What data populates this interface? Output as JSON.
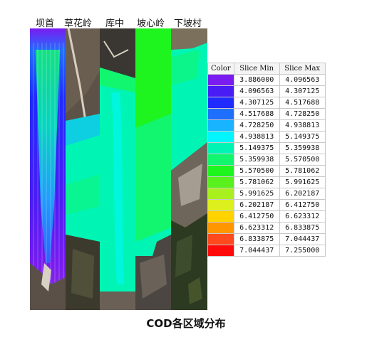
{
  "chart_data": {
    "type": "heatmap",
    "title": "COD各区域分布",
    "stations": [
      "坝首",
      "草花岭",
      "库中",
      "坡心岭",
      "下坡村"
    ],
    "legend_headers": [
      "Color",
      "Slice Min",
      "Slice Max"
    ],
    "bins": [
      {
        "min": "3.886000",
        "max": "4.096563",
        "color": "#7a1cf0"
      },
      {
        "min": "4.096563",
        "max": "4.307125",
        "color": "#4a1cf5"
      },
      {
        "min": "4.307125",
        "max": "4.517688",
        "color": "#1f2bff"
      },
      {
        "min": "4.517688",
        "max": "4.728250",
        "color": "#1f6fff"
      },
      {
        "min": "4.728250",
        "max": "4.938813",
        "color": "#18b4ff"
      },
      {
        "min": "4.938813",
        "max": "5.149375",
        "color": "#00f5ff"
      },
      {
        "min": "5.149375",
        "max": "5.359938",
        "color": "#00f5b4"
      },
      {
        "min": "5.359938",
        "max": "5.570500",
        "color": "#12f56e"
      },
      {
        "min": "5.570500",
        "max": "5.781062",
        "color": "#1ef51e"
      },
      {
        "min": "5.781062",
        "max": "5.991625",
        "color": "#5af01e"
      },
      {
        "min": "5.991625",
        "max": "6.202187",
        "color": "#a8f01e"
      },
      {
        "min": "6.202187",
        "max": "6.412750",
        "color": "#dcf01e"
      },
      {
        "min": "6.412750",
        "max": "6.623312",
        "color": "#ffd200"
      },
      {
        "min": "6.623312",
        "max": "6.833875",
        "color": "#ff9600"
      },
      {
        "min": "6.833875",
        "max": "7.044437",
        "color": "#ff4a1e"
      },
      {
        "min": "7.044437",
        "max": "7.255000",
        "color": "#ff0a0a"
      }
    ]
  }
}
